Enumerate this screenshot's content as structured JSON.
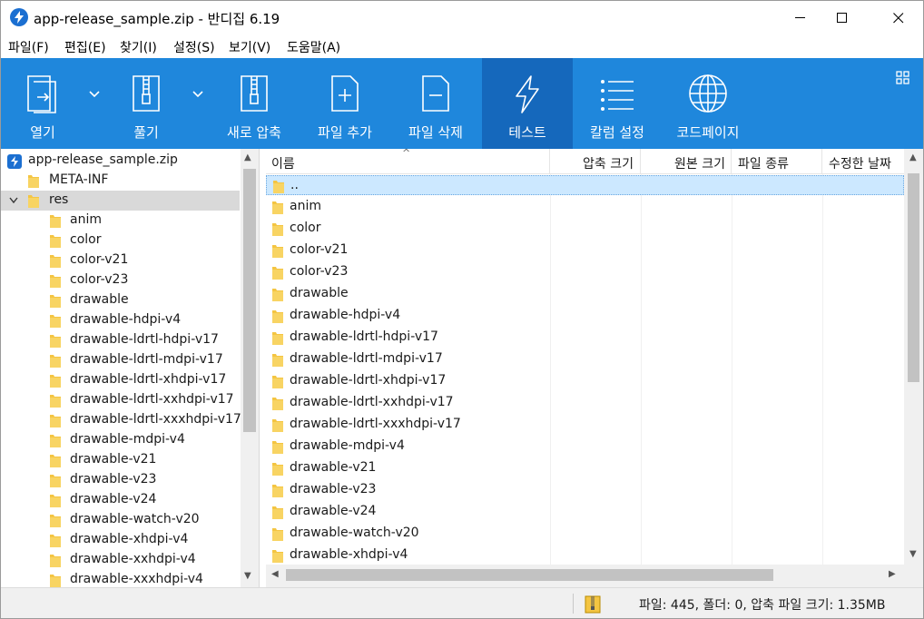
{
  "window": {
    "title": "app-release_sample.zip - 반디집 6.19"
  },
  "menu": [
    "파일(F)",
    "편집(E)",
    "찾기(I)",
    "설정(S)",
    "보기(V)",
    "도움말(A)"
  ],
  "toolbar": {
    "open": "열기",
    "extract": "풀기",
    "new_archive": "새로 압축",
    "add_file": "파일 추가",
    "delete_file": "파일 삭제",
    "test": "테스트",
    "column_settings": "칼럼 설정",
    "codepage": "코드페이지"
  },
  "tree": {
    "root": "app-release_sample.zip",
    "top_items": [
      "META-INF",
      "res"
    ],
    "res_children": [
      "anim",
      "color",
      "color-v21",
      "color-v23",
      "drawable",
      "drawable-hdpi-v4",
      "drawable-ldrtl-hdpi-v17",
      "drawable-ldrtl-mdpi-v17",
      "drawable-ldrtl-xhdpi-v17",
      "drawable-ldrtl-xxhdpi-v17",
      "drawable-ldrtl-xxxhdpi-v17",
      "drawable-mdpi-v4",
      "drawable-v21",
      "drawable-v23",
      "drawable-v24",
      "drawable-watch-v20",
      "drawable-xhdpi-v4",
      "drawable-xxhdpi-v4",
      "drawable-xxxhdpi-v4"
    ]
  },
  "list": {
    "columns": [
      "이름",
      "압축 크기",
      "원본 크기",
      "파일 종류",
      "수정한 날짜"
    ],
    "rows": [
      "..",
      "anim",
      "color",
      "color-v21",
      "color-v23",
      "drawable",
      "drawable-hdpi-v4",
      "drawable-ldrtl-hdpi-v17",
      "drawable-ldrtl-mdpi-v17",
      "drawable-ldrtl-xhdpi-v17",
      "drawable-ldrtl-xxhdpi-v17",
      "drawable-ldrtl-xxxhdpi-v17",
      "drawable-mdpi-v4",
      "drawable-v21",
      "drawable-v23",
      "drawable-v24",
      "drawable-watch-v20",
      "drawable-xhdpi-v4"
    ]
  },
  "status": {
    "summary": "파일: 445, 폴더: 0, 압축 파일 크기: 1.35MB"
  },
  "colors": {
    "toolbar_bg": "#1f87dc",
    "toolbar_active": "#1568bc",
    "folder": "#f4c542",
    "selection": "#cce8ff"
  },
  "icons": {
    "app": "bandizip-logo-icon",
    "zip": "zip-file-icon",
    "folder": "folder-icon"
  }
}
